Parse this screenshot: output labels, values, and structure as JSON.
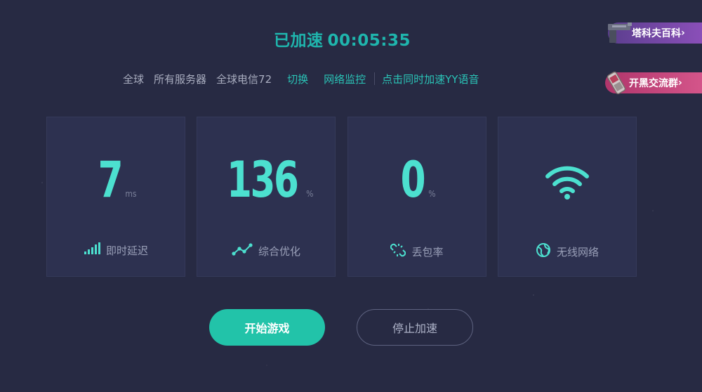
{
  "status": {
    "label": "已加速",
    "time": "00:05:35"
  },
  "subbar": {
    "region": "全球",
    "servers": "所有服务器",
    "network": "全球电信72",
    "switch_label": "切换",
    "monitor_label": "网络监控",
    "voice_label": "点击同时加速YY语音"
  },
  "side": {
    "wiki_label": "塔科夫百科",
    "group_label": "开黑交流群"
  },
  "stats": [
    {
      "value": "7",
      "unit": "ms",
      "label": "即时延迟",
      "icon": "signal-bars-icon"
    },
    {
      "value": "136",
      "unit": "%",
      "label": "综合优化",
      "icon": "trend-line-icon"
    },
    {
      "value": "0",
      "unit": "%",
      "label": "丢包率",
      "icon": "broken-link-icon"
    },
    {
      "value": "",
      "unit": "",
      "label": "无线网络",
      "icon": "wifi-icon"
    }
  ],
  "buttons": {
    "start_label": "开始游戏",
    "stop_label": "停止加速"
  },
  "colors": {
    "accent": "#22c3a9",
    "stat": "#4ce0cf",
    "background": "#272a43",
    "card": "#2d3150"
  }
}
